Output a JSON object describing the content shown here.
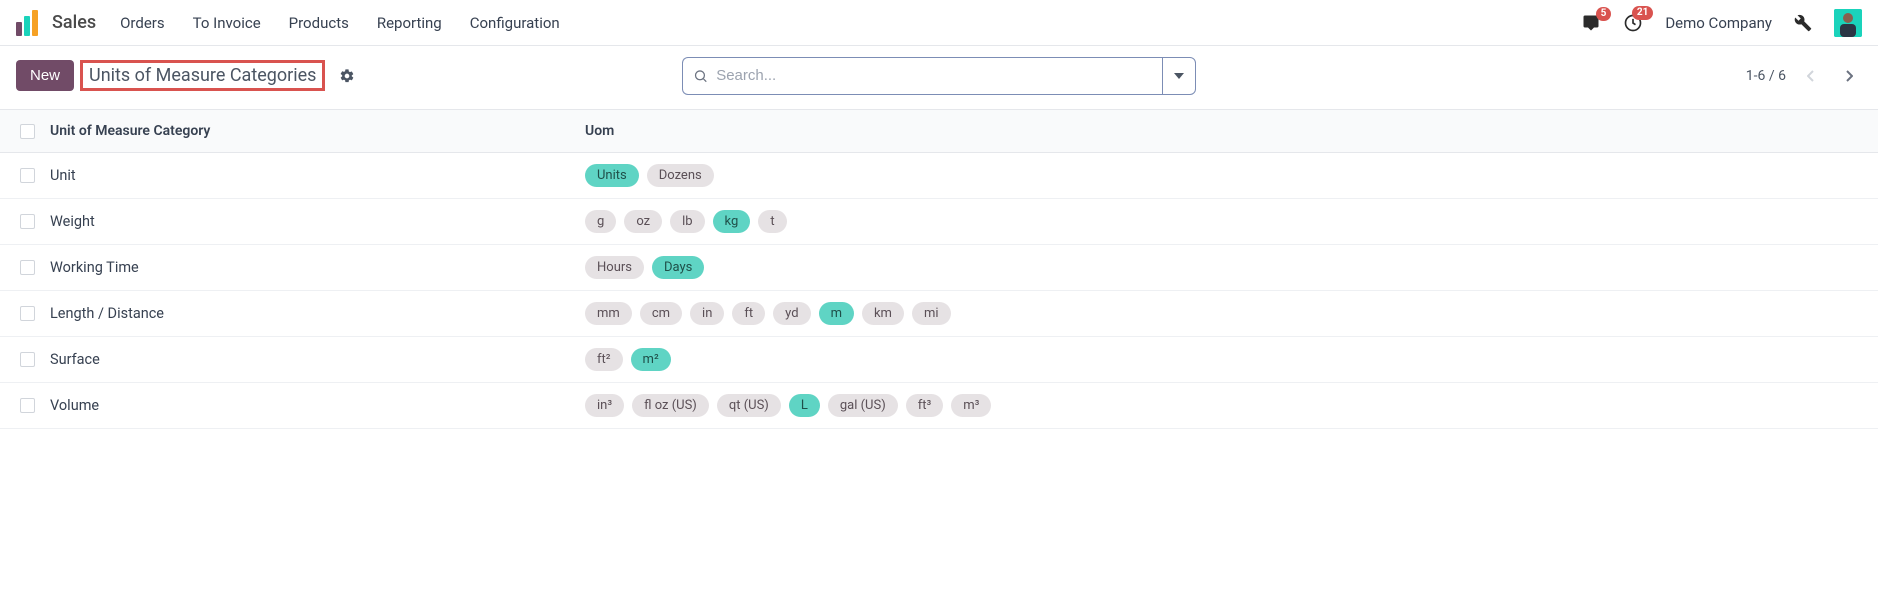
{
  "nav": {
    "app_name": "Sales",
    "items": [
      "Orders",
      "To Invoice",
      "Products",
      "Reporting",
      "Configuration"
    ],
    "messages_badge": "5",
    "activities_badge": "21",
    "company": "Demo Company"
  },
  "action": {
    "new_label": "New",
    "breadcrumb": "Units of Measure Categories",
    "search_placeholder": "Search...",
    "pager": "1-6 / 6"
  },
  "table": {
    "headers": {
      "category": "Unit of Measure Category",
      "uom": "Uom"
    },
    "rows": [
      {
        "name": "Unit",
        "uoms": [
          {
            "label": "Units",
            "ref": true
          },
          {
            "label": "Dozens",
            "ref": false
          }
        ]
      },
      {
        "name": "Weight",
        "uoms": [
          {
            "label": "g",
            "ref": false
          },
          {
            "label": "oz",
            "ref": false
          },
          {
            "label": "lb",
            "ref": false
          },
          {
            "label": "kg",
            "ref": true
          },
          {
            "label": "t",
            "ref": false
          }
        ]
      },
      {
        "name": "Working Time",
        "uoms": [
          {
            "label": "Hours",
            "ref": false
          },
          {
            "label": "Days",
            "ref": true
          }
        ]
      },
      {
        "name": "Length / Distance",
        "uoms": [
          {
            "label": "mm",
            "ref": false
          },
          {
            "label": "cm",
            "ref": false
          },
          {
            "label": "in",
            "ref": false
          },
          {
            "label": "ft",
            "ref": false
          },
          {
            "label": "yd",
            "ref": false
          },
          {
            "label": "m",
            "ref": true
          },
          {
            "label": "km",
            "ref": false
          },
          {
            "label": "mi",
            "ref": false
          }
        ]
      },
      {
        "name": "Surface",
        "uoms": [
          {
            "label": "ft²",
            "ref": false
          },
          {
            "label": "m²",
            "ref": true
          }
        ]
      },
      {
        "name": "Volume",
        "uoms": [
          {
            "label": "in³",
            "ref": false
          },
          {
            "label": "fl oz (US)",
            "ref": false
          },
          {
            "label": "qt (US)",
            "ref": false
          },
          {
            "label": "L",
            "ref": true
          },
          {
            "label": "gal (US)",
            "ref": false
          },
          {
            "label": "ft³",
            "ref": false
          },
          {
            "label": "m³",
            "ref": false
          }
        ]
      }
    ]
  }
}
